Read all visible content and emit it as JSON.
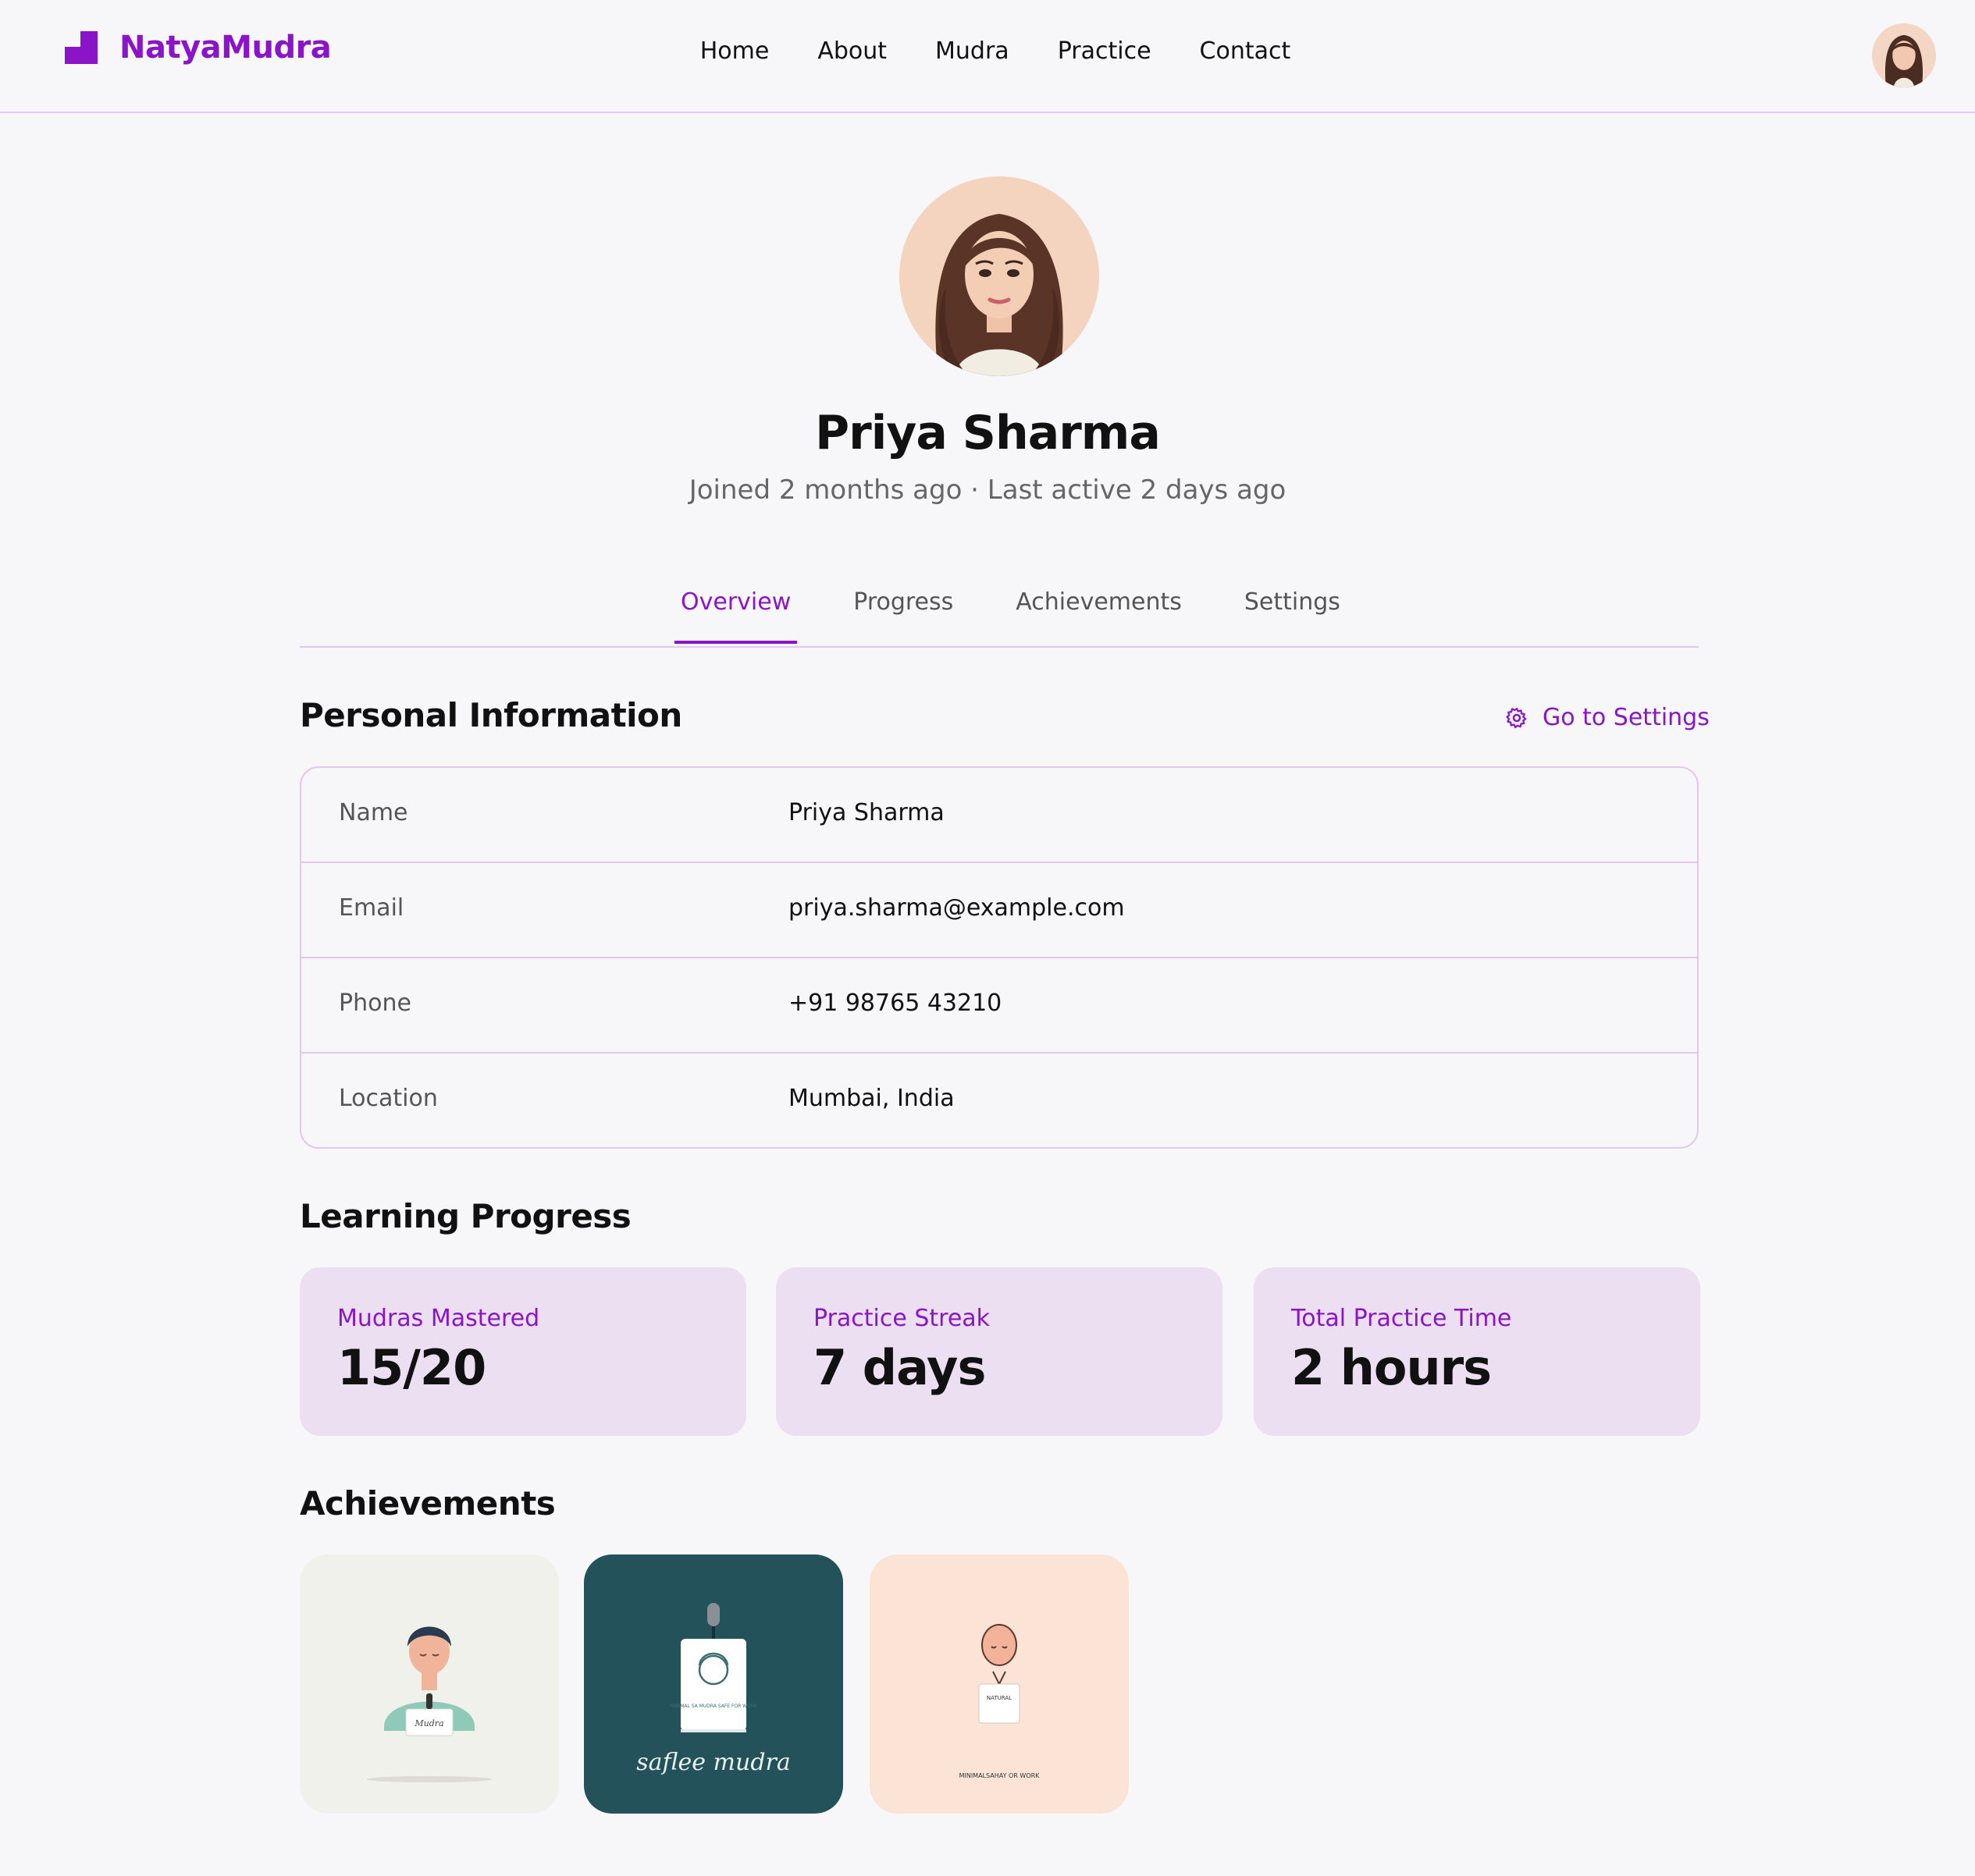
{
  "header": {
    "brand": "NatyaMudra",
    "nav": [
      "Home",
      "About",
      "Mudra",
      "Practice",
      "Contact"
    ]
  },
  "profile": {
    "name": "Priya Sharma",
    "meta": "Joined 2 months ago · Last active 2 days ago"
  },
  "tabs": [
    "Overview",
    "Progress",
    "Achievements",
    "Settings"
  ],
  "personal": {
    "title": "Personal Information",
    "settings_link": "Go to Settings",
    "rows": [
      {
        "label": "Name",
        "value": "Priya Sharma"
      },
      {
        "label": "Email",
        "value": "priya.sharma@example.com"
      },
      {
        "label": "Phone",
        "value": "+91 98765 43210"
      },
      {
        "label": "Location",
        "value": "Mumbai, India"
      }
    ]
  },
  "progress": {
    "title": "Learning Progress",
    "stats": [
      {
        "label": "Mudras Mastered",
        "value": "15/20"
      },
      {
        "label": "Practice Streak",
        "value": "7 days"
      },
      {
        "label": "Total Practice Time",
        "value": "2 hours"
      }
    ]
  },
  "achievements": {
    "title": "Achievements",
    "items": [
      {
        "badge_text": "Mudra"
      },
      {
        "caption": "saflee mudra",
        "badge_text": "MINIMAL SA MUDRA SAFE FOR WORK"
      },
      {
        "badge_text": "NATURAL",
        "caption": "MINIMALSAHAY OR WORK"
      }
    ]
  },
  "colors": {
    "accent": "#8a14c8",
    "card_bg": "#ecdff2",
    "border": "#e2c8ec"
  }
}
